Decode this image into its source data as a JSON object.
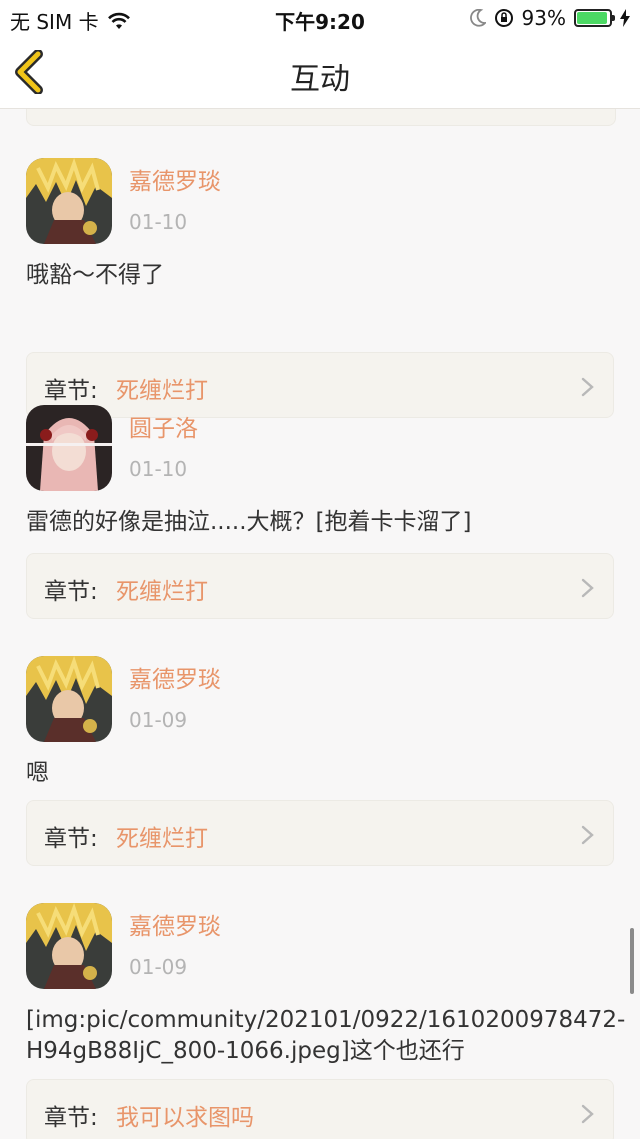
{
  "status_bar": {
    "carrier": "无 SIM 卡",
    "time": "下午9:20",
    "battery_percent": "93%",
    "battery_level": 0.93
  },
  "nav": {
    "title": "互动",
    "back_icon": "chevron-left-icon"
  },
  "comments": [
    {
      "username": "嘉德罗琰",
      "date": "01-10",
      "text": "哦豁～不得了",
      "chapter_label": "章节:",
      "chapter_name": "死缠烂打",
      "avatar": "blonde-character-avatar"
    },
    {
      "username": "圆子洛",
      "date": "01-10",
      "text": "雷德的好像是抽泣.....大概？[抱着卡卡溜了]",
      "chapter_label": "章节:",
      "chapter_name": "死缠烂打",
      "avatar": "pink-hair-character-avatar"
    },
    {
      "username": "嘉德罗琰",
      "date": "01-09",
      "text": "嗯",
      "chapter_label": "章节:",
      "chapter_name": "死缠烂打",
      "avatar": "blonde-character-avatar"
    },
    {
      "username": "嘉德罗琰",
      "date": "01-09",
      "text_line1": "[img:pic/community/202101/0922/1610200978472-",
      "text_line2": "H94gB88IjC_800-1066.jpeg]这个也还行",
      "chapter_label": "章节:",
      "chapter_name": "我可以求图吗",
      "avatar": "blonde-character-avatar"
    }
  ],
  "colors": {
    "accent": "#e8956a",
    "back_arrow": "#f0c419",
    "card_bg": "#f5f3ee",
    "page_bg": "#f8f7f7",
    "battery_green": "#4cd964"
  }
}
